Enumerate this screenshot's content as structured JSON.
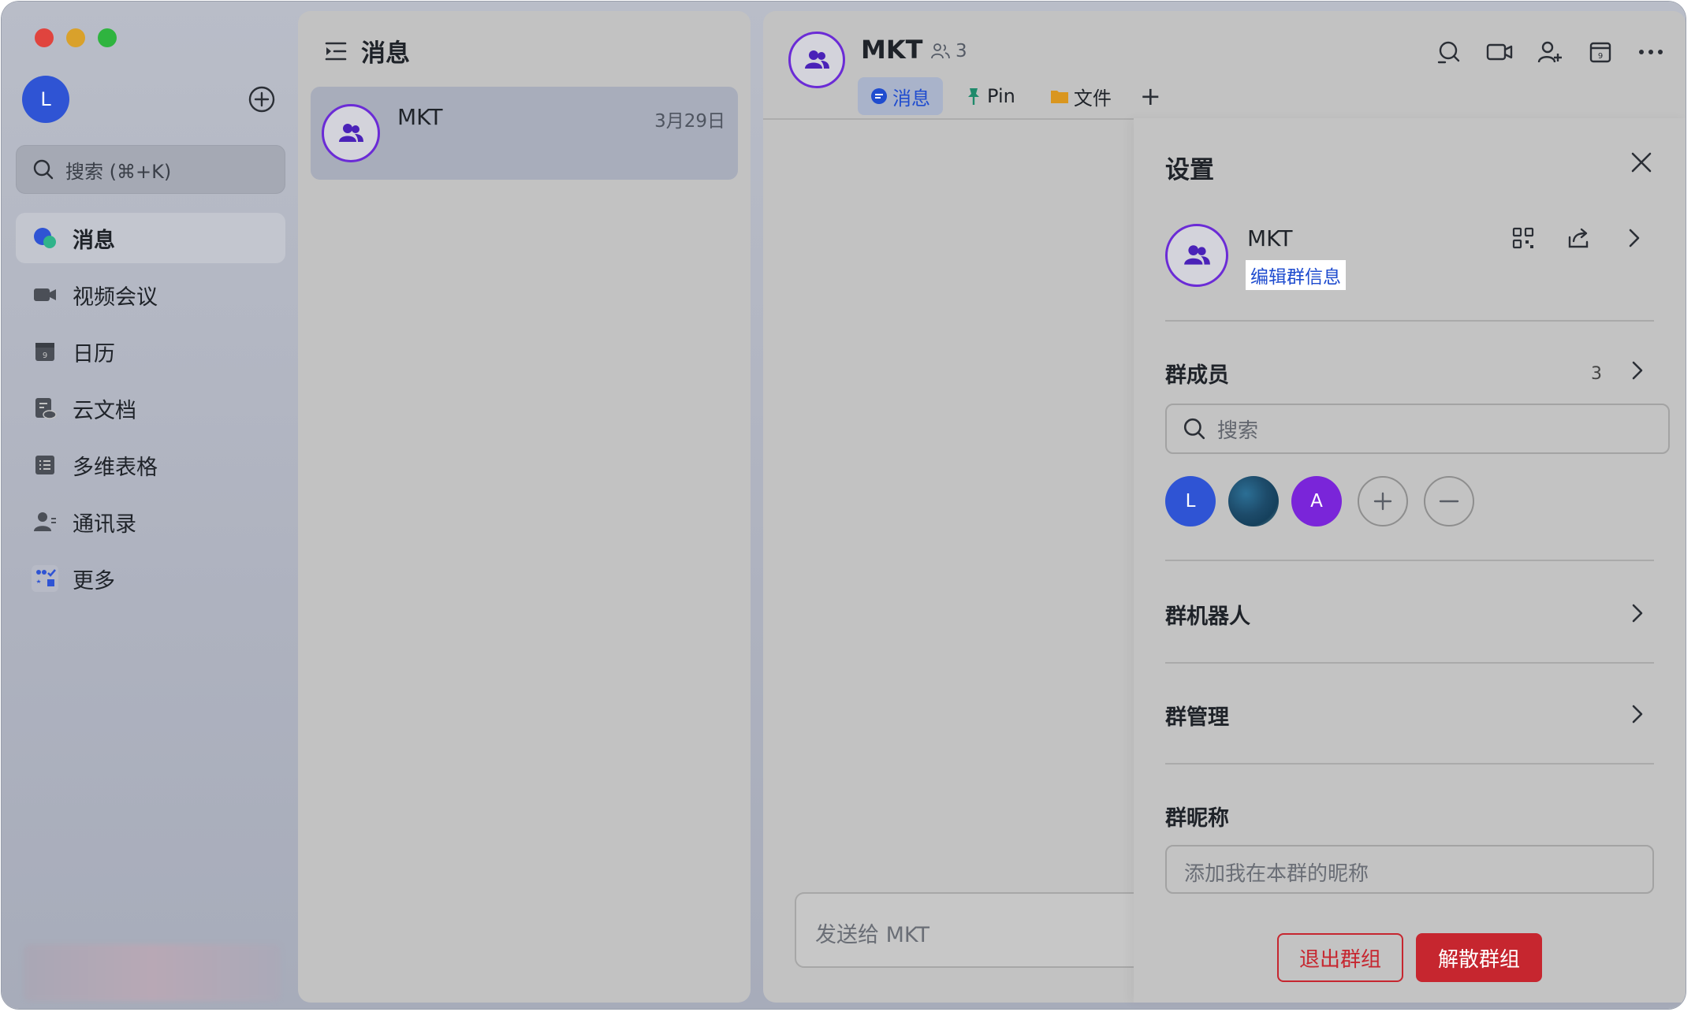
{
  "sidebar": {
    "avatar_initial": "L",
    "search_placeholder": "搜索 (⌘+K)",
    "items": [
      {
        "label": "消息",
        "icon": "chat-bubble-icon",
        "active": true
      },
      {
        "label": "视频会议",
        "icon": "video-camera-icon"
      },
      {
        "label": "日历",
        "icon": "calendar-icon"
      },
      {
        "label": "云文档",
        "icon": "cloud-doc-icon"
      },
      {
        "label": "多维表格",
        "icon": "base-table-icon"
      },
      {
        "label": "通讯录",
        "icon": "contacts-icon"
      },
      {
        "label": "更多",
        "icon": "more-apps-icon"
      }
    ]
  },
  "conversation_list": {
    "title": "消息",
    "items": [
      {
        "name": "MKT",
        "date": "3月29日"
      }
    ]
  },
  "chat": {
    "title": "MKT",
    "member_count": "3",
    "tabs": [
      {
        "label": "消息",
        "active": true
      },
      {
        "label": "Pin"
      },
      {
        "label": "文件"
      }
    ],
    "tab_add": "+",
    "composer_placeholder": "发送给 MKT"
  },
  "settings": {
    "title": "设置",
    "group_name": "MKT",
    "edit_link": "编辑群信息",
    "members_title": "群成员",
    "members_count": "3",
    "member_search_placeholder": "搜索",
    "members": [
      {
        "initial": "L",
        "color": "#2f54d4"
      },
      {
        "initial": "",
        "color": "#1d4b6a"
      },
      {
        "initial": "A",
        "color": "#7a25d9"
      }
    ],
    "bots_title": "群机器人",
    "manage_title": "群管理",
    "nickname_title": "群昵称",
    "nickname_placeholder": "添加我在本群的昵称",
    "leave_button": "退出群组",
    "dismiss_button": "解散群组"
  },
  "colors": {
    "accent_blue": "#1f4ccf",
    "group_purple": "#6b2bd6",
    "danger_red": "#c6262f"
  }
}
